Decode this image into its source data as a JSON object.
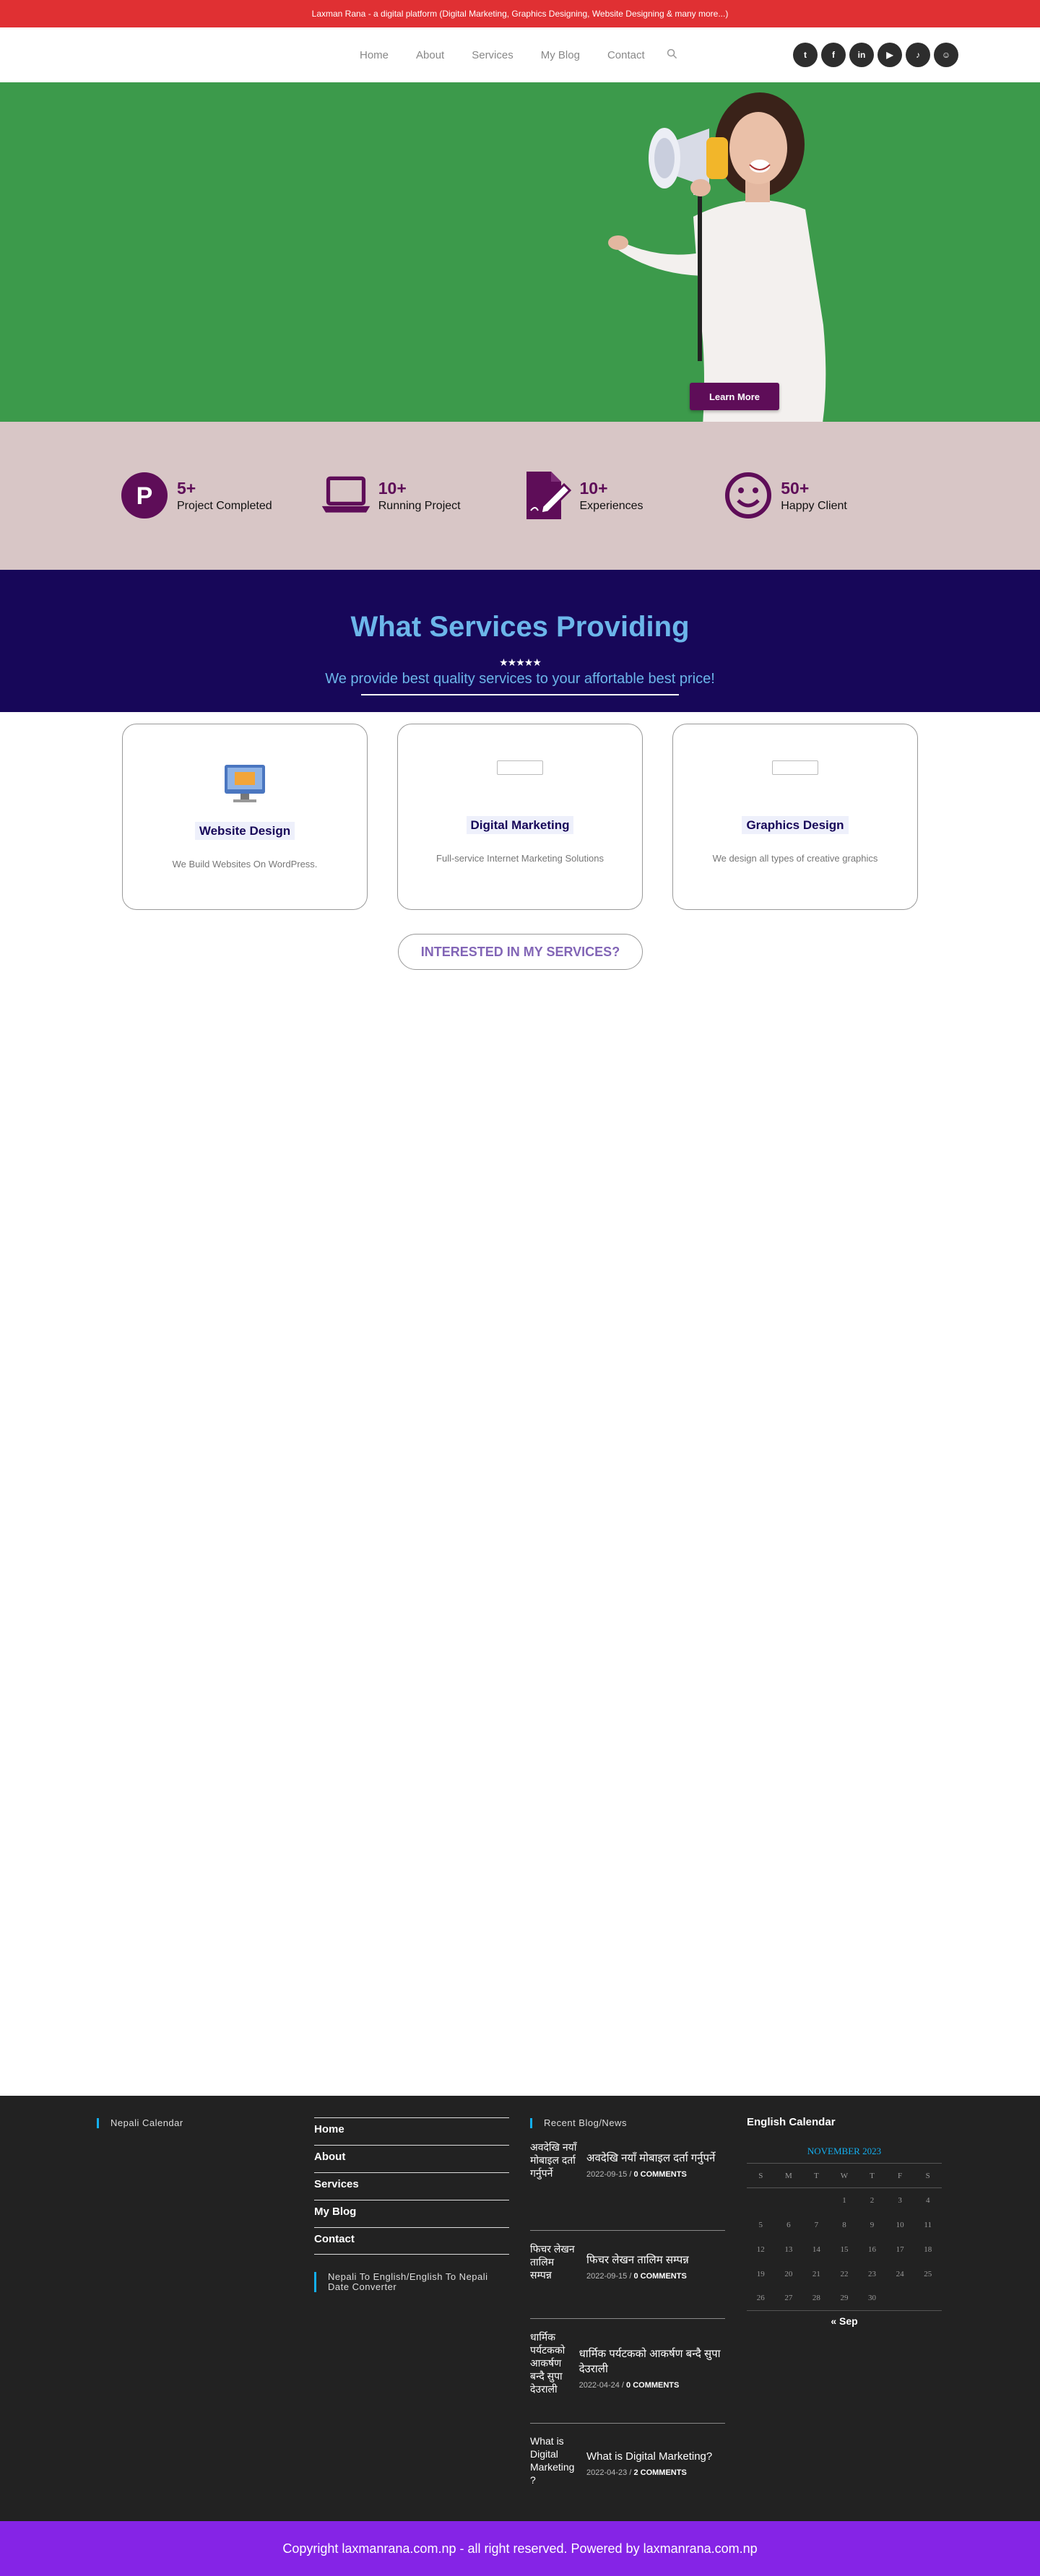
{
  "topbar": {
    "text": "Laxman Rana - a digital platform (Digital Marketing, Graphics Designing, Website Designing & many more...)"
  },
  "nav": {
    "items": [
      "Home",
      "About",
      "Services",
      "My Blog",
      "Contact"
    ],
    "search_icon": "search-icon"
  },
  "social": {
    "icons": [
      "twitter-icon",
      "facebook-icon",
      "linkedin-icon",
      "youtube-icon",
      "tiktok-icon",
      "snapchat-icon"
    ],
    "glyphs": [
      "t",
      "f",
      "in",
      "▶",
      "♪",
      "☺"
    ]
  },
  "hero": {
    "button_label": "Learn More",
    "bg_color": "#3c9a4b"
  },
  "stats": [
    {
      "number": "5+",
      "label": "Project Completed",
      "icon": "parking-p-icon"
    },
    {
      "number": "10+",
      "label": "Running Project",
      "icon": "laptop-icon"
    },
    {
      "number": "10+",
      "label": "Experiences",
      "icon": "document-edit-icon"
    },
    {
      "number": "50+",
      "label": "Happy Client",
      "icon": "smiley-icon"
    }
  ],
  "services_section": {
    "title": "What Services Providing",
    "stars": "★★★★★",
    "subtitle": "We provide best quality services to your affortable best price!"
  },
  "services": [
    {
      "title": "Website Design",
      "desc": "We Build Websites On WordPress."
    },
    {
      "title": "Digital Marketing",
      "desc": "Full-service Internet Marketing Solutions"
    },
    {
      "title": "Graphics Design",
      "desc": "We design all types of creative graphics"
    }
  ],
  "interest_button": "INTERESTED IN MY SERVICES?",
  "footer": {
    "nepali_calendar_heading": "Nepali Calendar",
    "menu": [
      "Home",
      "About",
      "Services",
      "My Blog",
      "Contact"
    ],
    "converter_heading": "Nepali To English/English To Nepali Date Converter",
    "blog_heading": "Recent Blog/News",
    "posts": [
      {
        "img_alt": "अवदेखि नयाँ मोबाइल दर्ता गर्नुपर्ने",
        "title": "अवदेखि नयाँ मोबाइल दर्ता गर्नुपर्ने",
        "date": "2022-09-15",
        "comments": "0 COMMENTS"
      },
      {
        "img_alt": "फिचर लेखन तालिम सम्पन्न",
        "title": "फिचर लेखन तालिम सम्पन्न",
        "date": "2022-09-15",
        "comments": "0 COMMENTS"
      },
      {
        "img_alt": "धार्मिक पर्यटकको आकर्षण बन्दै सुपा देउराली",
        "title": "धार्मिक पर्यटकको आकर्षण बन्दै सुपा देउराली",
        "date": "2022-04-24",
        "comments": "0 COMMENTS"
      },
      {
        "img_alt": "What is Digital Marketing?",
        "title": "What is Digital Marketing?",
        "date": "2022-04-23",
        "comments": "2 COMMENTS"
      }
    ],
    "calendar": {
      "heading": "English Calendar",
      "month": "NOVEMBER 2023",
      "weekdays": [
        "S",
        "M",
        "T",
        "W",
        "T",
        "F",
        "S"
      ],
      "weeks": [
        [
          "",
          "",
          "",
          "1",
          "2",
          "3",
          "4"
        ],
        [
          "5",
          "6",
          "7",
          "8",
          "9",
          "10",
          "11"
        ],
        [
          "12",
          "13",
          "14",
          "15",
          "16",
          "17",
          "18"
        ],
        [
          "19",
          "20",
          "21",
          "22",
          "23",
          "24",
          "25"
        ],
        [
          "26",
          "27",
          "28",
          "29",
          "30",
          "",
          ""
        ]
      ],
      "prev": "« Sep"
    },
    "copyright": "Copyright laxmanrana.com.np - all right reserved. Powered by laxmanrana.com.np"
  }
}
